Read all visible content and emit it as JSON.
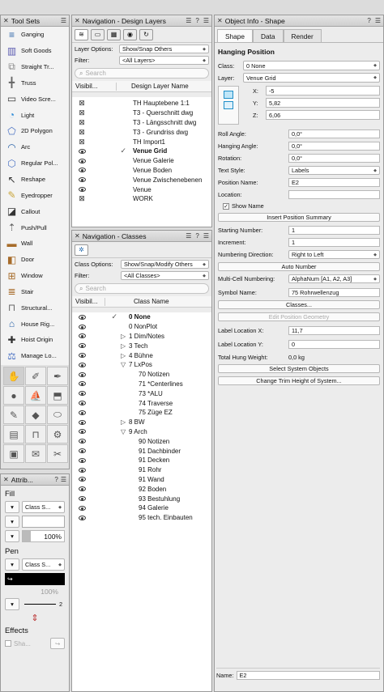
{
  "tool_sets": {
    "title": "Tool Sets",
    "tools": [
      {
        "label": "Ganging",
        "icon": "ganging-icon"
      },
      {
        "label": "Soft Goods",
        "icon": "soft-goods-icon"
      },
      {
        "label": "Straight Tr...",
        "icon": "straight-truss-icon"
      },
      {
        "label": "Truss",
        "icon": "truss-icon"
      },
      {
        "label": "Video Scre...",
        "icon": "video-screen-icon"
      },
      {
        "label": "Light",
        "icon": "light-icon"
      },
      {
        "label": "2D Polygon",
        "icon": "polygon-icon"
      },
      {
        "label": "Arc",
        "icon": "arc-icon"
      },
      {
        "label": "Regular Pol...",
        "icon": "regular-polygon-icon"
      },
      {
        "label": "Reshape",
        "icon": "reshape-icon"
      },
      {
        "label": "Eyedropper",
        "icon": "eyedropper-icon"
      },
      {
        "label": "Callout",
        "icon": "callout-icon"
      },
      {
        "label": "Push/Pull",
        "icon": "push-pull-icon"
      },
      {
        "label": "Wall",
        "icon": "wall-icon"
      },
      {
        "label": "Door",
        "icon": "door-icon"
      },
      {
        "label": "Window",
        "icon": "window-icon"
      },
      {
        "label": "Stair",
        "icon": "stair-icon"
      },
      {
        "label": "Structural...",
        "icon": "structural-icon"
      },
      {
        "label": "House Rig...",
        "icon": "house-rigging-icon"
      },
      {
        "label": "Hoist Origin",
        "icon": "hoist-origin-icon"
      },
      {
        "label": "Manage Lo...",
        "icon": "manage-loads-icon"
      }
    ],
    "palette_icons": [
      "hand-icon",
      "pencil-icon",
      "pen-icon",
      "ball-icon",
      "boat-icon",
      "mask-icon",
      "brush-icon",
      "shapes-icon",
      "cylinder-icon",
      "drawer-icon",
      "beam-icon",
      "gear-icon",
      "box-icon",
      "envelope-icon",
      "wrench-icon"
    ]
  },
  "attributes": {
    "title": "Attrib...",
    "fill_label": "Fill",
    "fill_class": "Class S...",
    "fill_opacity": "100%",
    "pen_label": "Pen",
    "pen_class": "Class S...",
    "pen_opacity": "100%",
    "line_weight": "2",
    "effects_label": "Effects",
    "shadow_label": "Sha..."
  },
  "design_layers": {
    "title": "Navigation - Design Layers",
    "layer_options_label": "Layer Options:",
    "layer_options_value": "Show/Snap Others",
    "filter_label": "Filter:",
    "filter_value": "<All Layers>",
    "search_placeholder": "Search",
    "col_visibility": "Visibil...",
    "col_name": "Design Layer Name",
    "rows": [
      {
        "vis": "x",
        "name": "TH Hauptebene 1:1",
        "active": false,
        "check": false
      },
      {
        "vis": "x",
        "name": "T3 - Querschnitt dwg",
        "active": false,
        "check": false
      },
      {
        "vis": "x",
        "name": "T3 - Längsschnitt dwg",
        "active": false,
        "check": false
      },
      {
        "vis": "x",
        "name": "T3 - Grundriss dwg",
        "active": false,
        "check": false
      },
      {
        "vis": "x",
        "name": "TH Import1",
        "active": false,
        "check": false
      },
      {
        "vis": "eye",
        "name": "Venue Grid",
        "active": true,
        "check": true
      },
      {
        "vis": "eye",
        "name": "Venue Galerie",
        "active": false,
        "check": false
      },
      {
        "vis": "eye",
        "name": "Venue Boden",
        "active": false,
        "check": false
      },
      {
        "vis": "eye",
        "name": "Venue Zwischenebenen",
        "active": false,
        "check": false
      },
      {
        "vis": "eye",
        "name": "Venue",
        "active": false,
        "check": false
      },
      {
        "vis": "x",
        "name": "WORK",
        "active": false,
        "check": false
      }
    ]
  },
  "classes": {
    "title": "Navigation - Classes",
    "class_options_label": "Class Options:",
    "class_options_value": "Show/Snap/Modify Others",
    "filter_label": "Filter:",
    "filter_value": "<All Classes>",
    "search_placeholder": "Search",
    "col_visibility": "Visibil...",
    "col_name": "Class Name",
    "rows": [
      {
        "name": "0 None",
        "indent": 0,
        "arrow": "",
        "bold": true,
        "check": true
      },
      {
        "name": "0 NonPlot",
        "indent": 0,
        "arrow": "",
        "bold": false,
        "check": false
      },
      {
        "name": "1 Dim/Notes",
        "indent": 0,
        "arrow": "▷",
        "bold": false,
        "check": false
      },
      {
        "name": "3 Tech",
        "indent": 0,
        "arrow": "▷",
        "bold": false,
        "check": false
      },
      {
        "name": "4 Bühne",
        "indent": 0,
        "arrow": "▷",
        "bold": false,
        "check": false
      },
      {
        "name": "7 LxPos",
        "indent": 0,
        "arrow": "▽",
        "bold": false,
        "check": false
      },
      {
        "name": "70 Notizen",
        "indent": 1,
        "arrow": "",
        "bold": false,
        "check": false
      },
      {
        "name": "71 *Centerlines",
        "indent": 1,
        "arrow": "",
        "bold": false,
        "check": false
      },
      {
        "name": "73 *ALU",
        "indent": 1,
        "arrow": "",
        "bold": false,
        "check": false
      },
      {
        "name": "74 Traverse",
        "indent": 1,
        "arrow": "",
        "bold": false,
        "check": false
      },
      {
        "name": "75 Züge EZ",
        "indent": 1,
        "arrow": "",
        "bold": false,
        "check": false
      },
      {
        "name": "8 BW",
        "indent": 0,
        "arrow": "▷",
        "bold": false,
        "check": false
      },
      {
        "name": "9 Arch",
        "indent": 0,
        "arrow": "▽",
        "bold": false,
        "check": false
      },
      {
        "name": "90 Notizen",
        "indent": 1,
        "arrow": "",
        "bold": false,
        "check": false
      },
      {
        "name": "91 Dachbinder",
        "indent": 1,
        "arrow": "",
        "bold": false,
        "check": false
      },
      {
        "name": "91 Decken",
        "indent": 1,
        "arrow": "",
        "bold": false,
        "check": false
      },
      {
        "name": "91 Rohr",
        "indent": 1,
        "arrow": "",
        "bold": false,
        "check": false
      },
      {
        "name": "91 Wand",
        "indent": 1,
        "arrow": "",
        "bold": false,
        "check": false
      },
      {
        "name": "92 Boden",
        "indent": 1,
        "arrow": "",
        "bold": false,
        "check": false
      },
      {
        "name": "93 Bestuhlung",
        "indent": 1,
        "arrow": "",
        "bold": false,
        "check": false
      },
      {
        "name": "94 Galerie",
        "indent": 1,
        "arrow": "",
        "bold": false,
        "check": false
      },
      {
        "name": "95 tech. Einbauten",
        "indent": 1,
        "arrow": "",
        "bold": false,
        "check": false
      }
    ]
  },
  "object_info": {
    "title": "Object Info - Shape",
    "tabs": [
      "Shape",
      "Data",
      "Render"
    ],
    "object_type": "Hanging Position",
    "class_label": "Class:",
    "class_value": "0 None",
    "layer_label": "Layer:",
    "layer_value": "Venue Grid",
    "x_label": "X:",
    "x_value": "-5",
    "y_label": "Y:",
    "y_value": "5,82",
    "z_label": "Z:",
    "z_value": "6,06",
    "fields": [
      {
        "label": "Roll Angle:",
        "value": "0,0°",
        "type": "input"
      },
      {
        "label": "Hanging Angle:",
        "value": "0,0°",
        "type": "input"
      },
      {
        "label": "Rotation:",
        "value": "0,0°",
        "type": "input"
      },
      {
        "label": "Text Style:",
        "value": "Labels",
        "type": "select"
      },
      {
        "label": "Position Name:",
        "value": "E2",
        "type": "input"
      },
      {
        "label": "Location:",
        "value": "",
        "type": "input"
      }
    ],
    "show_name_label": "Show Name",
    "insert_summary_button": "Insert Position Summary",
    "fields2": [
      {
        "label": "Starting Number:",
        "value": "1",
        "type": "input"
      },
      {
        "label": "Increment:",
        "value": "1",
        "type": "input"
      },
      {
        "label": "Numbering Direction:",
        "value": "Right to Left",
        "type": "select"
      }
    ],
    "auto_number_button": "Auto Number",
    "multicell_label": "Multi-Cell Numbering:",
    "multicell_value": "AlphaNum [A1, A2, A3]",
    "symbol_name_label": "Symbol Name:",
    "symbol_name_value": "75 Rohrwellenzug",
    "classes_button": "Classes...",
    "edit_geometry_button": "Edit Position Geometry",
    "label_loc_x_label": "Label Location X:",
    "label_loc_x_value": "11,7",
    "label_loc_y_label": "Label Location Y:",
    "label_loc_y_value": "0",
    "hung_weight_label": "Total Hung Weight:",
    "hung_weight_value": "0,0 kg",
    "select_system_button": "Select System Objects",
    "change_trim_button": "Change Trim Height of System...",
    "name_label": "Name:",
    "name_value": "E2"
  }
}
